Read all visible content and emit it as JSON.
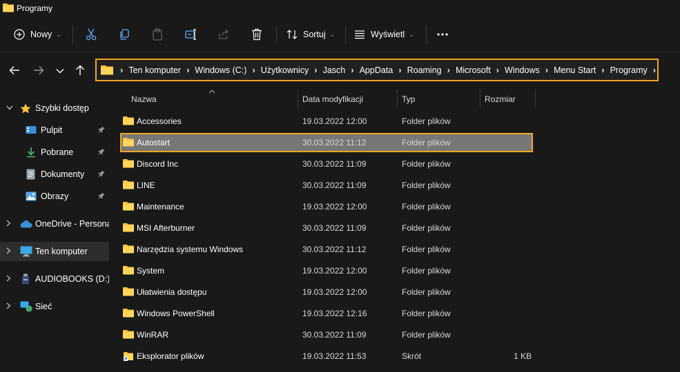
{
  "window": {
    "title": "Programy"
  },
  "toolbar": {
    "new_label": "Nowy",
    "sort_label": "Sortuj",
    "view_label": "Wyświetl",
    "icons": [
      "plus-circle-icon",
      "cut-icon",
      "copy-icon",
      "paste-icon",
      "rename-icon",
      "share-icon",
      "delete-icon",
      "sort-icon",
      "view-icon",
      "more-icon"
    ]
  },
  "address": {
    "crumbs": [
      "Ten komputer",
      "Windows (C:)",
      "Użytkownicy",
      "Jasch",
      "AppData",
      "Roaming",
      "Microsoft",
      "Windows",
      "Menu Start",
      "Programy"
    ]
  },
  "sidebar": {
    "quick_access": "Szybki dostęp",
    "items": [
      {
        "label": "Pulpit",
        "icon": "desktop-icon",
        "pinned": true
      },
      {
        "label": "Pobrane",
        "icon": "download-icon",
        "pinned": true
      },
      {
        "label": "Dokumenty",
        "icon": "documents-icon",
        "pinned": true
      },
      {
        "label": "Obrazy",
        "icon": "pictures-icon",
        "pinned": true
      }
    ],
    "onedrive": "OneDrive - Personal",
    "this_pc": "Ten komputer",
    "drive_d": "AUDIOBOOKS (D:)",
    "network": "Sieć"
  },
  "columns": {
    "name": "Nazwa",
    "date": "Data modyfikacji",
    "type": "Typ",
    "size": "Rozmiar"
  },
  "files": [
    {
      "name": "Accessories",
      "date": "19.03.2022 12:00",
      "type": "Folder plików",
      "size": ""
    },
    {
      "name": "Autostart",
      "date": "30.03.2022 11:12",
      "type": "Folder plików",
      "size": "",
      "selected": true
    },
    {
      "name": "Discord Inc",
      "date": "30.03.2022 11:09",
      "type": "Folder plików",
      "size": ""
    },
    {
      "name": "LINE",
      "date": "30.03.2022 11:09",
      "type": "Folder plików",
      "size": ""
    },
    {
      "name": "Maintenance",
      "date": "19.03.2022 12:00",
      "type": "Folder plików",
      "size": ""
    },
    {
      "name": "MSI Afterburner",
      "date": "30.03.2022 11:09",
      "type": "Folder plików",
      "size": ""
    },
    {
      "name": "Narzędzia systemu Windows",
      "date": "30.03.2022 11:12",
      "type": "Folder plików",
      "size": ""
    },
    {
      "name": "System",
      "date": "19.03.2022 12:00",
      "type": "Folder plików",
      "size": ""
    },
    {
      "name": "Ułatwienia dostępu",
      "date": "19.03.2022 12:00",
      "type": "Folder plików",
      "size": ""
    },
    {
      "name": "Windows PowerShell",
      "date": "19.03.2022 12:16",
      "type": "Folder plików",
      "size": ""
    },
    {
      "name": "WinRAR",
      "date": "30.03.2022 11:09",
      "type": "Folder plików",
      "size": ""
    },
    {
      "name": "Eksplorator plików",
      "date": "19.03.2022 11:53",
      "type": "Skrót",
      "size": "1 KB",
      "icon": "shortcut-icon"
    }
  ],
  "colors": {
    "accent_highlight": "#f5a623",
    "folder": "#f6c342",
    "selected_row": "#777777",
    "background": "#191919"
  }
}
